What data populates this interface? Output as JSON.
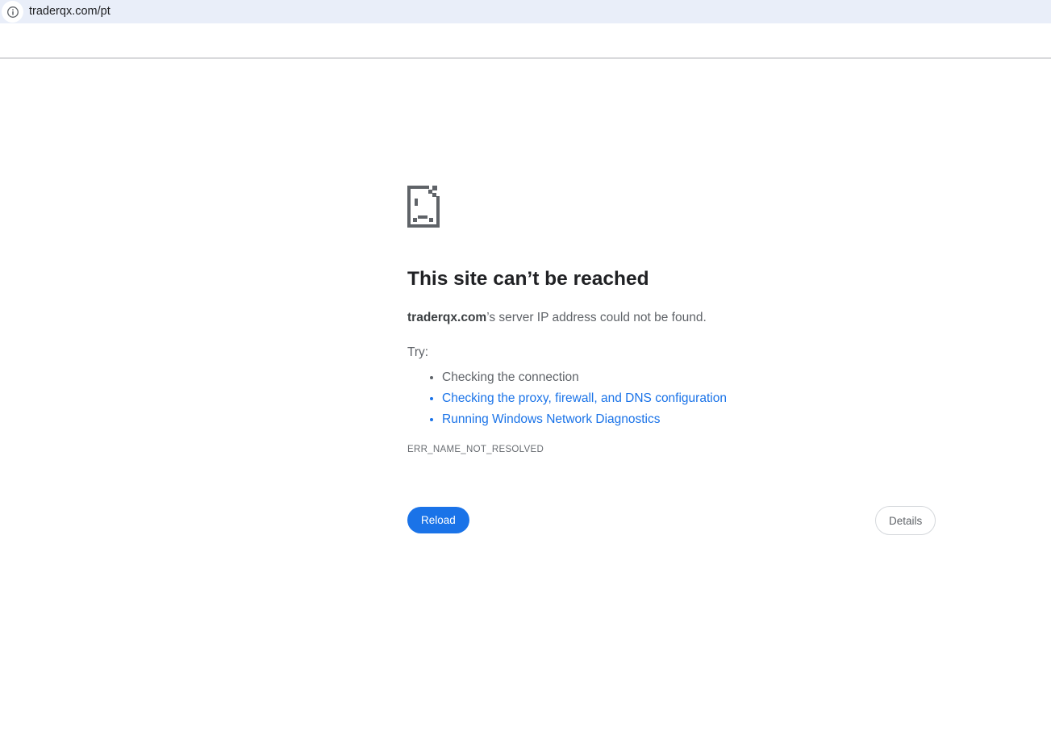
{
  "browser": {
    "url": "traderqx.com/pt",
    "site_info_icon": "info-icon"
  },
  "error_page": {
    "page_icon": "sad-file-icon",
    "title": "This site can’t be reached",
    "host": "traderqx.com",
    "subtitle_rest": "’s server IP address could not be found.",
    "try_label": "Try:",
    "suggestions": [
      {
        "label": "Checking the connection",
        "is_link": false
      },
      {
        "label": "Checking the proxy, firewall, and DNS configuration",
        "is_link": true
      },
      {
        "label": "Running Windows Network Diagnostics",
        "is_link": true
      }
    ],
    "error_code": "ERR_NAME_NOT_RESOLVED",
    "reload_label": "Reload",
    "details_label": "Details"
  },
  "colors": {
    "omnibox_bg": "#e9eef9",
    "accent_blue": "#1a73e8",
    "link_blue": "#1a73e8",
    "text_primary": "#202124",
    "text_secondary": "#5f6368",
    "icon_gray": "#5f6368",
    "divider": "#d9dadc"
  }
}
